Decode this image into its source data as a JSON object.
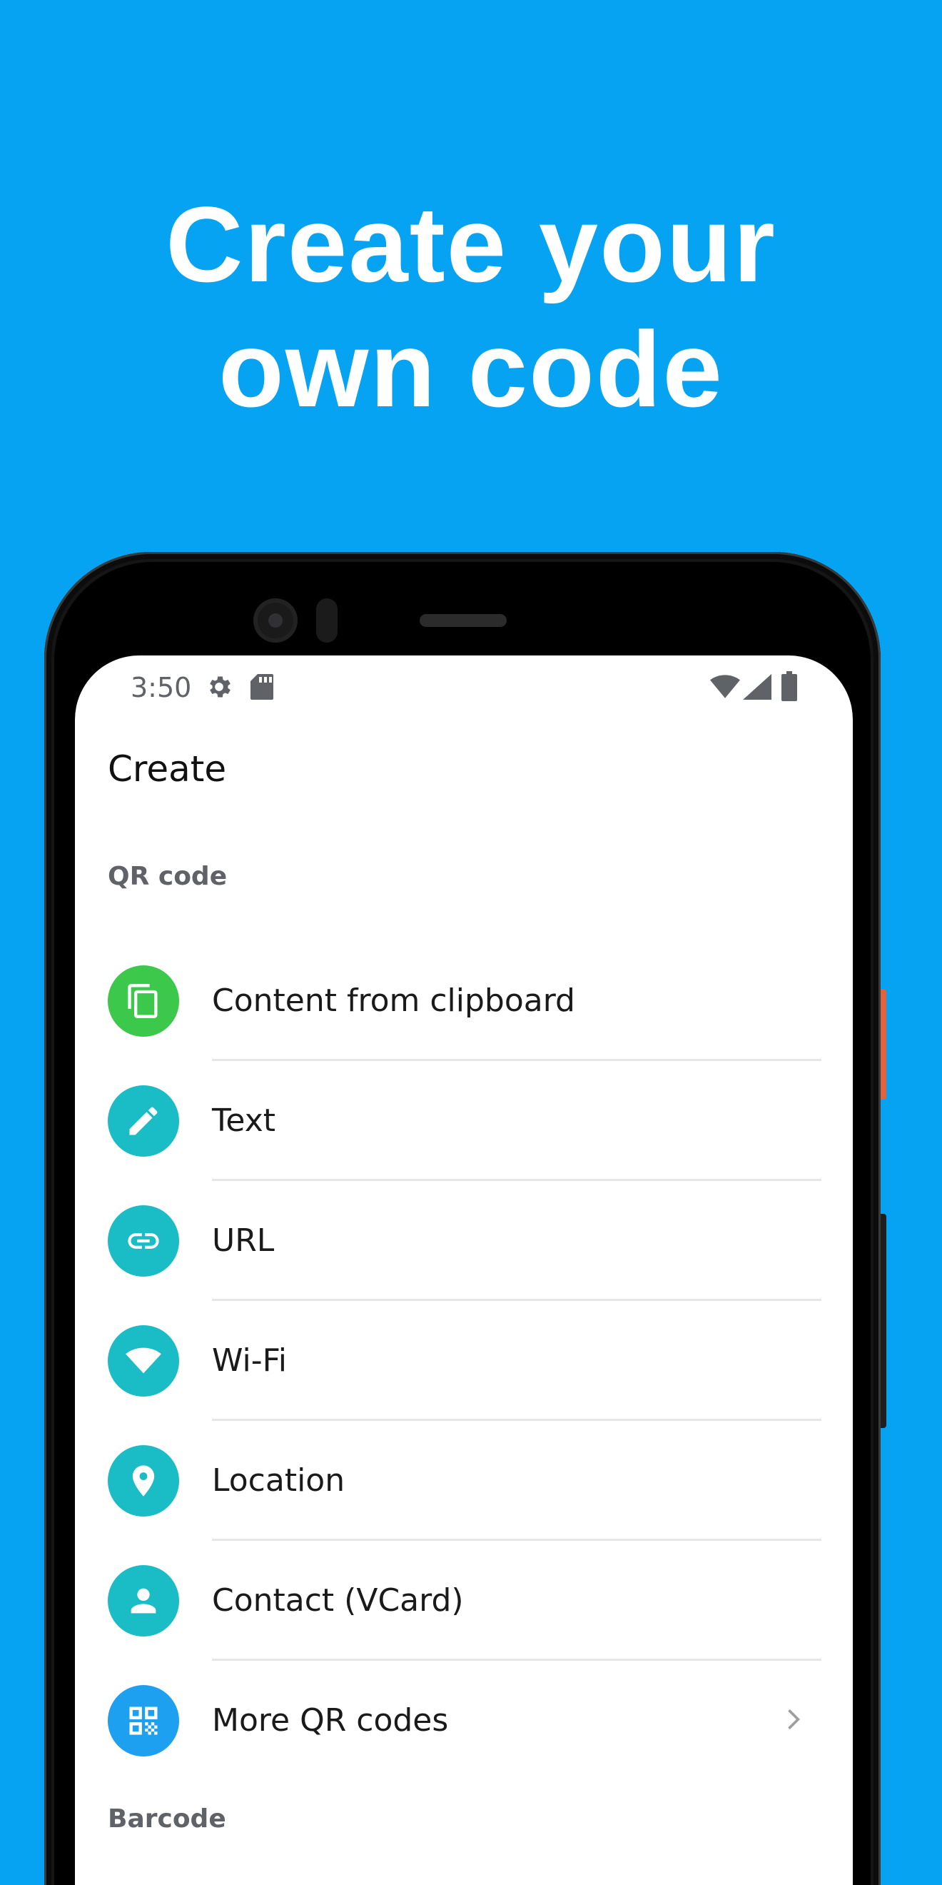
{
  "promo": {
    "headline_line1": "Create your",
    "headline_line2": "own code"
  },
  "statusbar": {
    "time": "3:50",
    "icons_left": [
      "gear-icon",
      "sd-card-icon"
    ],
    "icons_right": [
      "wifi-icon",
      "cell-signal-icon",
      "battery-icon"
    ]
  },
  "screen": {
    "title": "Create",
    "sections": [
      {
        "header": "QR code",
        "items": [
          {
            "label": "Content from clipboard",
            "icon": "clipboard-icon",
            "color": "#3CC84B"
          },
          {
            "label": "Text",
            "icon": "pencil-icon",
            "color": "#1ABCC6"
          },
          {
            "label": "URL",
            "icon": "link-icon",
            "color": "#1ABCC6"
          },
          {
            "label": "Wi-Fi",
            "icon": "wifi-icon",
            "color": "#1ABCC6"
          },
          {
            "label": "Location",
            "icon": "location-pin-icon",
            "color": "#1ABCC6"
          },
          {
            "label": "Contact (VCard)",
            "icon": "person-icon",
            "color": "#1ABCC6"
          },
          {
            "label": "More QR codes",
            "icon": "qr-code-icon",
            "color": "#1EA0F0"
          }
        ]
      },
      {
        "header": "Barcode",
        "items": []
      }
    ]
  },
  "colors": {
    "background": "#06A3F2",
    "clipboard_green": "#3CC84B",
    "teal": "#1ABCC6",
    "blue": "#1EA0F0"
  }
}
